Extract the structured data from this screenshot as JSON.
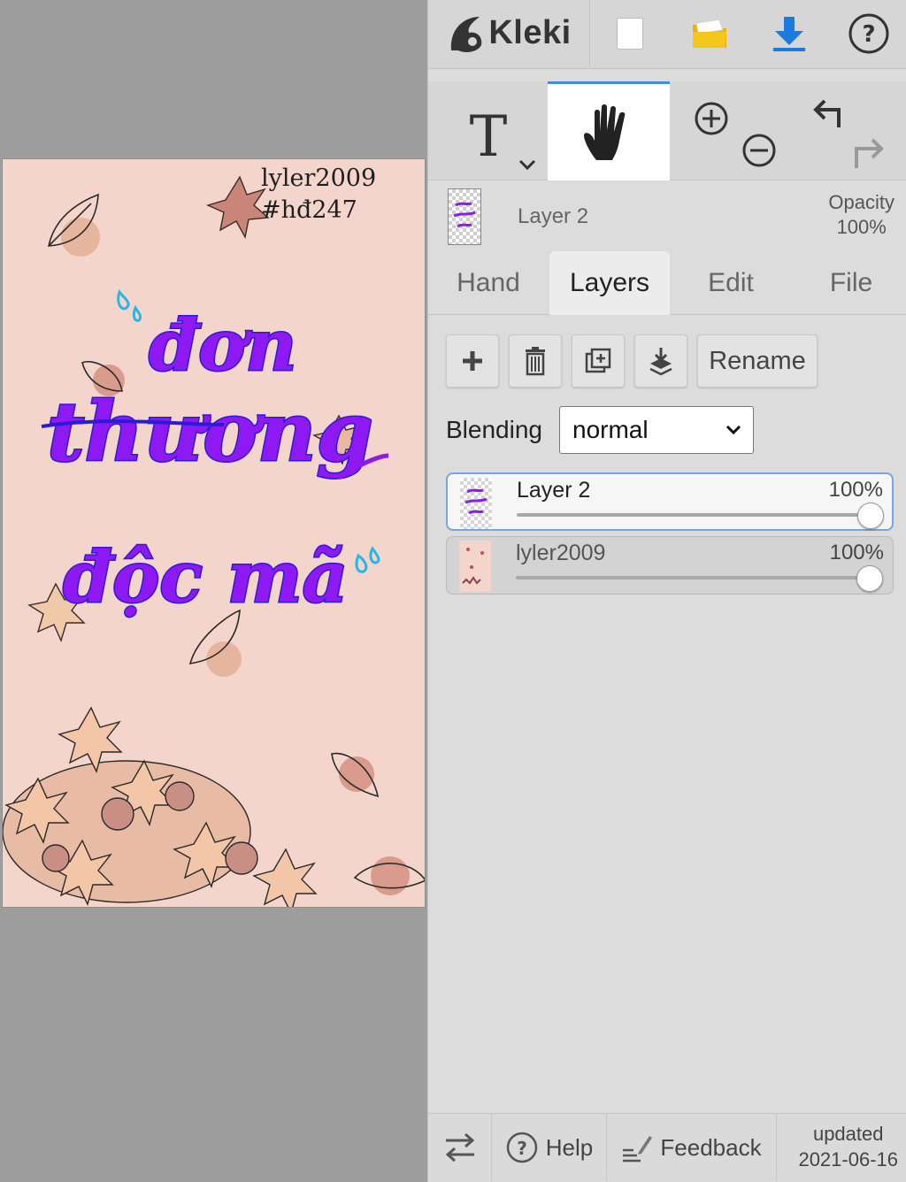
{
  "app": {
    "name": "Kleki"
  },
  "artwork": {
    "signature_line1": "lyler2009",
    "signature_line2": "#hđ247",
    "text_line1": "đơn",
    "text_line2": "thương",
    "text_line3": "độc mã",
    "background_color": "#f3d5cc",
    "text_color": "#8a1cf0",
    "outline_color": "#2b1bd6"
  },
  "topbar": {
    "new_icon": "new-file-icon",
    "open_icon": "folder-icon",
    "save_icon": "download-icon",
    "help_icon": "help-circle-icon"
  },
  "tools": {
    "text_tool_icon": "text-tool-icon",
    "hand_tool_icon": "hand-icon",
    "zoom_in_icon": "zoom-in-icon",
    "zoom_out_icon": "zoom-out-icon",
    "undo_icon": "undo-icon",
    "redo_icon": "redo-icon"
  },
  "current_layer": {
    "name": "Layer 2",
    "opacity_label": "Opacity",
    "opacity_value": "100%"
  },
  "tabs": [
    {
      "label": "Hand",
      "active": false
    },
    {
      "label": "Layers",
      "active": true
    },
    {
      "label": "Edit",
      "active": false
    },
    {
      "label": "File",
      "active": false
    }
  ],
  "layers_panel": {
    "rename_label": "Rename",
    "blending_label": "Blending",
    "blending_value": "normal",
    "layers": [
      {
        "name": "Layer 2",
        "opacity": "100%",
        "opacity_fraction": 1.0,
        "selected": true
      },
      {
        "name": "lyler2009",
        "opacity": "100%",
        "opacity_fraction": 1.0,
        "selected": false
      }
    ]
  },
  "bottombar": {
    "help_label": "Help",
    "feedback_label": "Feedback",
    "updated_line1": "updated",
    "updated_line2": "2021-06-16"
  },
  "colors": {
    "accent": "#3e8edb",
    "download": "#1a7be0",
    "folder": "#f5b800"
  }
}
